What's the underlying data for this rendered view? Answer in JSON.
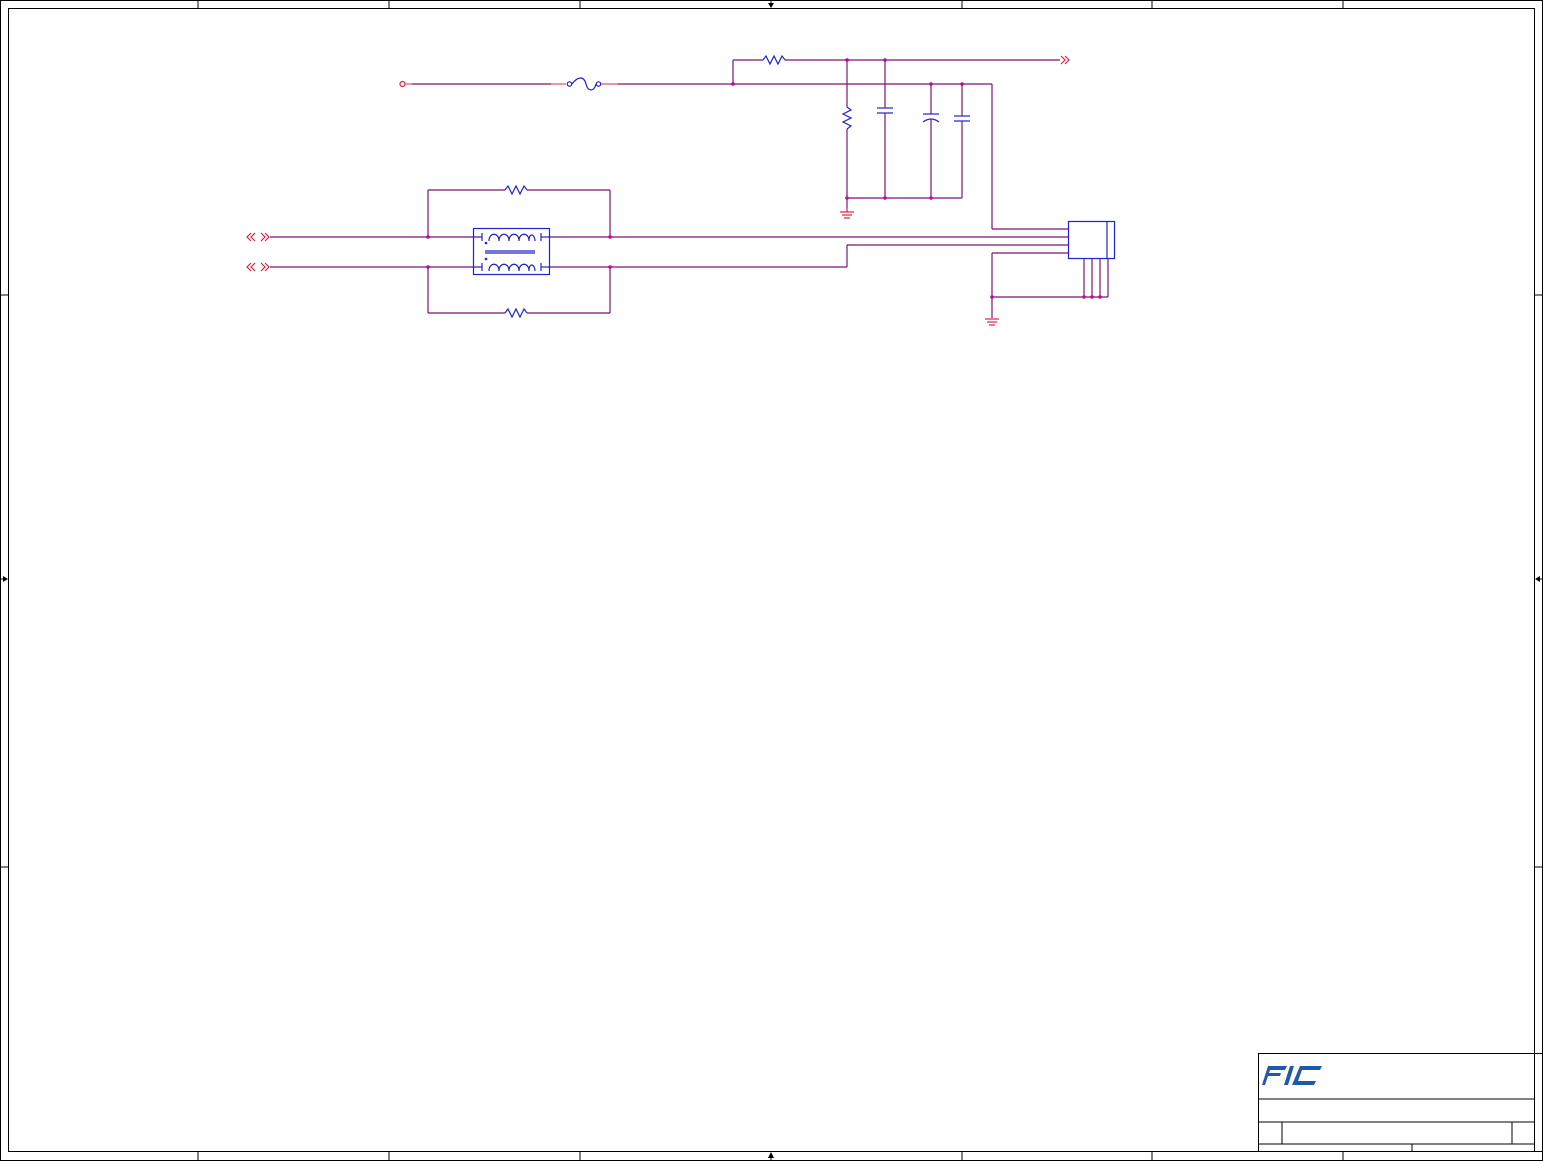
{
  "sheet": {
    "logo_text": "FIC"
  },
  "colors": {
    "wire": "#7a1670",
    "component": "#2222cc",
    "port": "#dd2244",
    "junction": "#d000a0",
    "logo": "#1f5aa6"
  }
}
